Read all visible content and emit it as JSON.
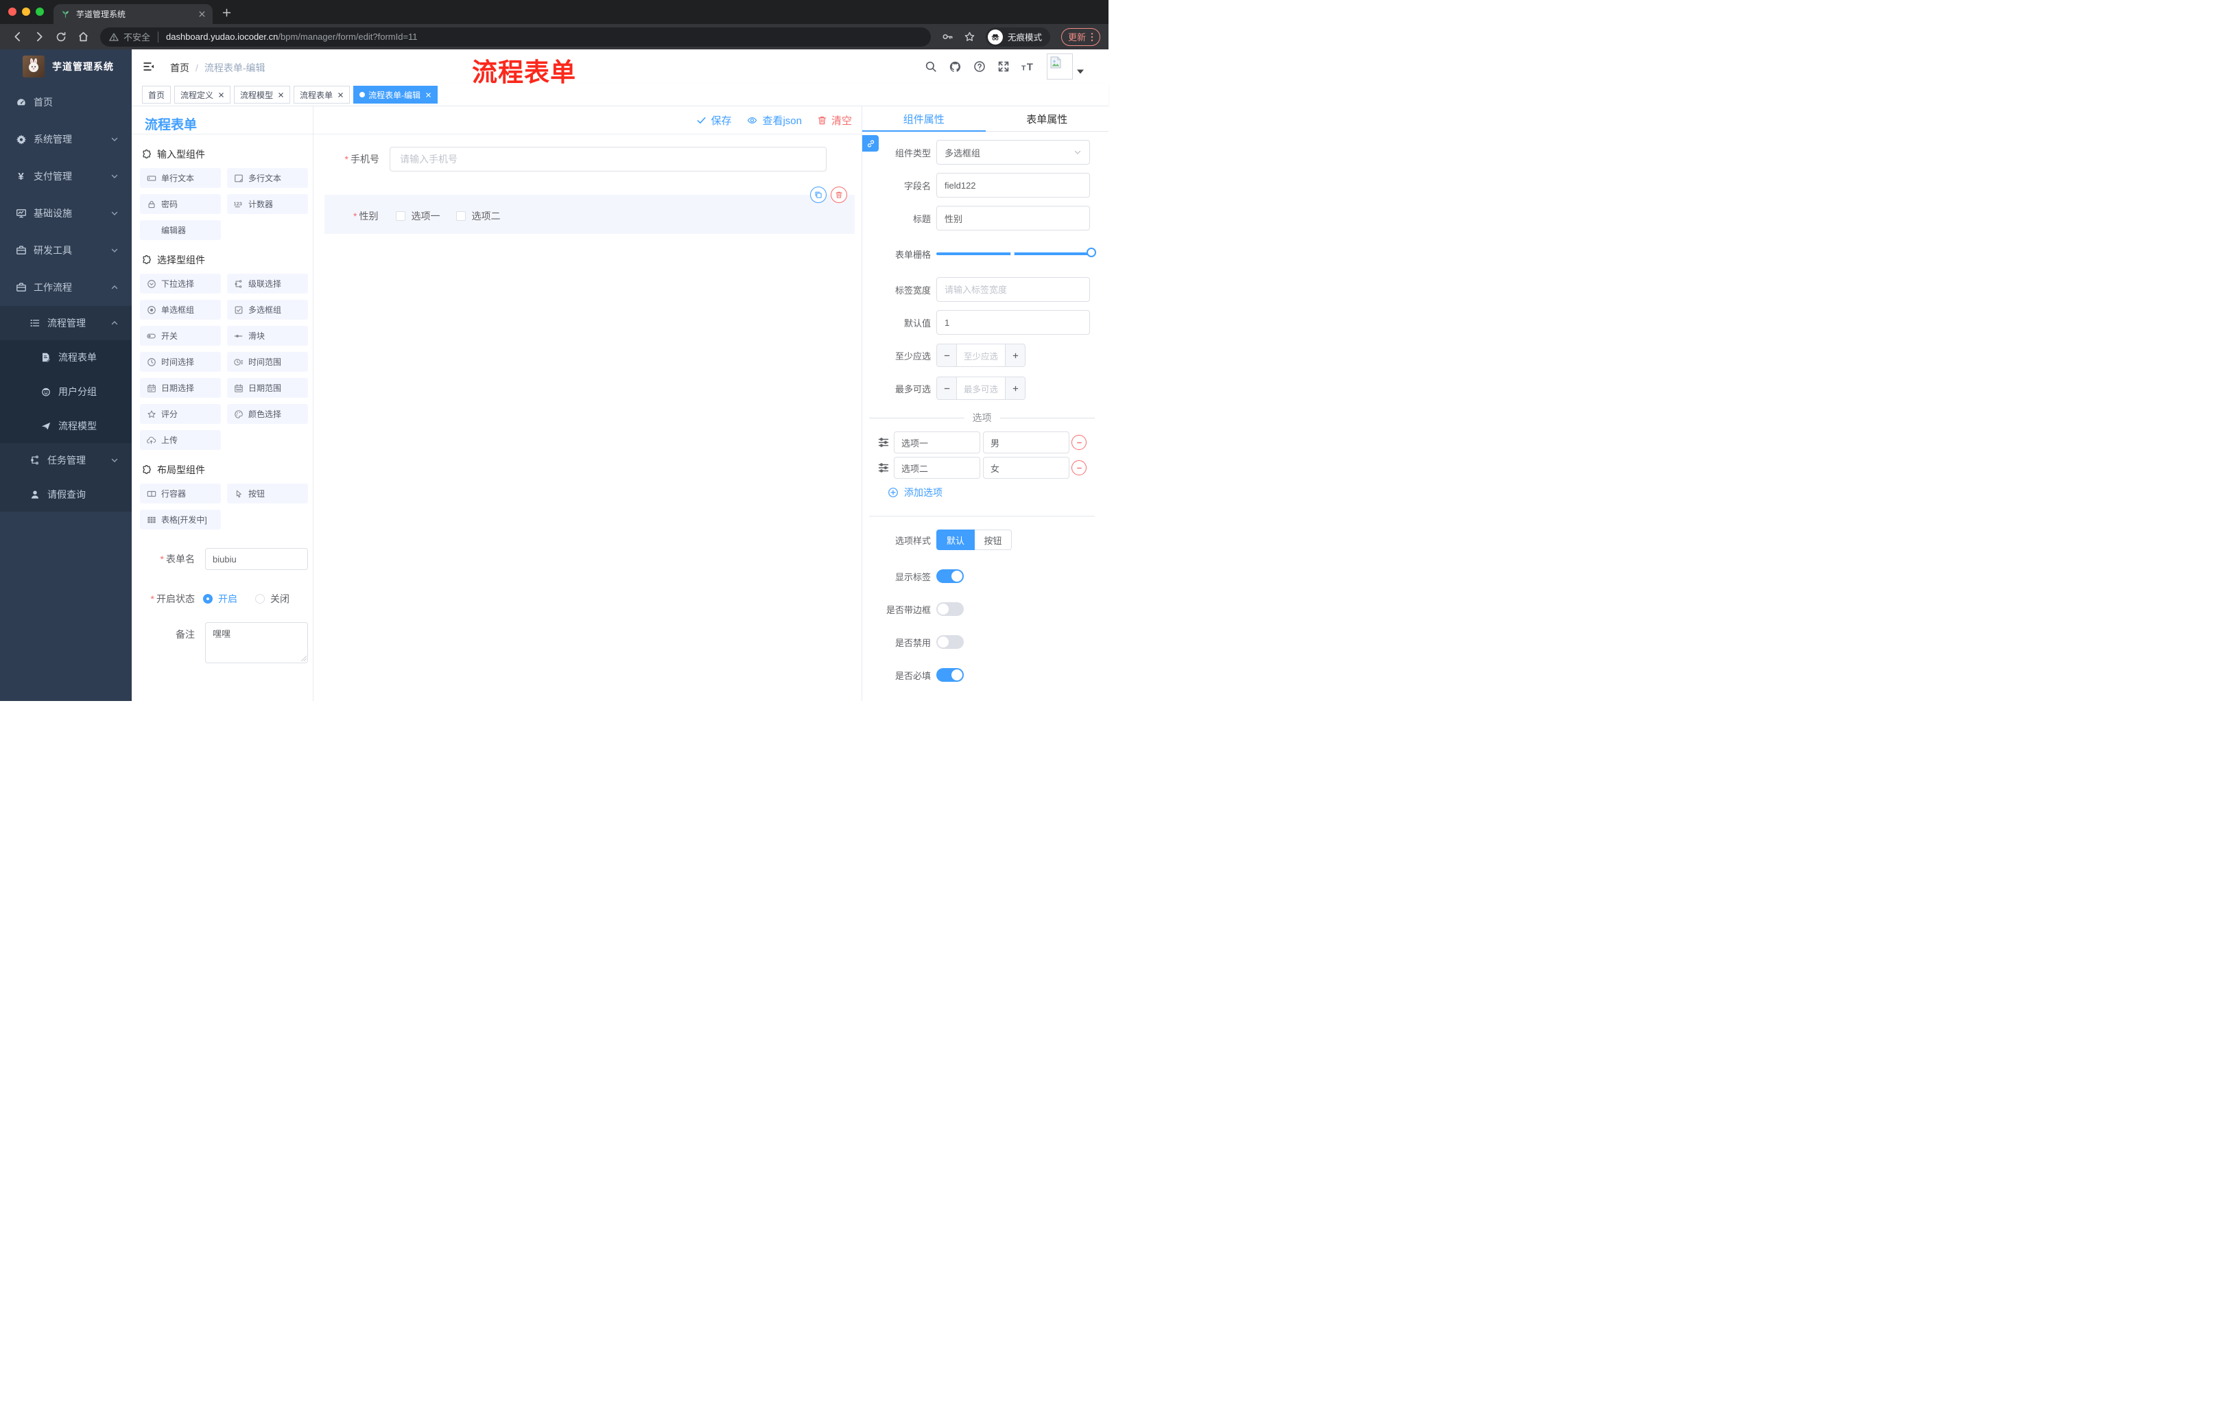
{
  "browser": {
    "tab_title": "芋道管理系统",
    "url_security": "不安全",
    "url_host": "dashboard.yudao.iocoder.cn",
    "url_path": "/bpm/manager/form/edit?formId=11",
    "incognito_label": "无痕模式",
    "update_label": "更新"
  },
  "sidebar": {
    "logo_title": "芋道管理系统",
    "items": [
      {
        "label": "首页"
      },
      {
        "label": "系统管理"
      },
      {
        "label": "支付管理"
      },
      {
        "label": "基础设施"
      },
      {
        "label": "研发工具"
      },
      {
        "label": "工作流程"
      },
      {
        "label": "流程管理"
      },
      {
        "label": "流程表单"
      },
      {
        "label": "用户分组"
      },
      {
        "label": "流程模型"
      },
      {
        "label": "任务管理"
      },
      {
        "label": "请假查询"
      }
    ]
  },
  "header": {
    "breadcrumb_home": "首页",
    "breadcrumb_separator": "/",
    "breadcrumb_current": "流程表单-编辑",
    "annotation": "流程表单"
  },
  "tags": [
    {
      "label": "首页"
    },
    {
      "label": "流程定义"
    },
    {
      "label": "流程模型"
    },
    {
      "label": "流程表单"
    },
    {
      "label": "流程表单-编辑"
    }
  ],
  "palette": {
    "title": "流程表单",
    "sections": [
      {
        "title": "输入型组件",
        "items": [
          "单行文本",
          "多行文本",
          "密码",
          "计数器",
          "编辑器"
        ]
      },
      {
        "title": "选择型组件",
        "items": [
          "下拉选择",
          "级联选择",
          "单选框组",
          "多选框组",
          "开关",
          "滑块",
          "时间选择",
          "时间范围",
          "日期选择",
          "日期范围",
          "评分",
          "颜色选择",
          "上传"
        ]
      },
      {
        "title": "布局型组件",
        "items": [
          "行容器",
          "按钮",
          "表格[开发中]"
        ]
      }
    ],
    "required_mark": "*",
    "form": {
      "name_label": "表单名",
      "name_value": "biubiu",
      "status_label": "开启状态",
      "status_on": "开启",
      "status_off": "关闭",
      "remark_label": "备注",
      "remark_value": "嘿嘿"
    }
  },
  "canvas": {
    "save_label": "保存",
    "view_json_label": "查看json",
    "clear_label": "清空",
    "phone_label": "手机号",
    "phone_placeholder": "请输入手机号",
    "gender_label": "性别",
    "gender_options": [
      "选项一",
      "选项二"
    ]
  },
  "panel": {
    "tabs": [
      "组件属性",
      "表单属性"
    ],
    "component_type_label": "组件类型",
    "component_type_value": "多选框组",
    "field_name_label": "字段名",
    "field_name_value": "field122",
    "title_label": "标题",
    "title_value": "性别",
    "grid_label": "表单栅格",
    "label_width_label": "标签宽度",
    "label_width_placeholder": "请输入标签宽度",
    "default_label": "默认值",
    "default_value": "1",
    "min_label": "至少应选",
    "min_placeholder": "至少应选",
    "max_label": "最多可选",
    "max_placeholder": "最多可选",
    "options_title": "选项",
    "options": [
      {
        "label": "选项一",
        "value": "男"
      },
      {
        "label": "选项二",
        "value": "女"
      }
    ],
    "add_option_label": "添加选项",
    "style_label": "选项样式",
    "style_default": "默认",
    "style_button": "按钮",
    "switches": [
      {
        "label": "显示标签"
      },
      {
        "label": "是否带边框"
      },
      {
        "label": "是否禁用"
      },
      {
        "label": "是否必填"
      }
    ]
  },
  "colors": {
    "accent": "#409eff",
    "danger": "#f56c6c",
    "annotation_red": "#fb281c",
    "sidebar_bg": "#2f3d52",
    "submenu_bg": "#263445",
    "submenu_deep_bg": "#1f2d3d",
    "browser_dark": "#202124",
    "browser_toolbar": "#35363a",
    "update_pill": "#ef8b82"
  }
}
